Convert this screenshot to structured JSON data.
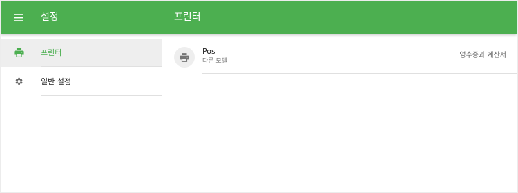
{
  "header": {
    "menu_icon": "hamburger-menu-icon",
    "title": "설정",
    "detail_title": "프린터"
  },
  "sidebar": {
    "items": [
      {
        "label": "프린터",
        "icon": "printer-icon",
        "selected": true
      },
      {
        "label": "일반 설정",
        "icon": "gear-icon",
        "selected": false
      }
    ]
  },
  "printers": [
    {
      "name": "Pos",
      "model": "다른 모델",
      "type": "영수증과 계산서",
      "icon": "printer-icon"
    }
  ],
  "colors": {
    "primary": "#4caf50",
    "selected_bg": "#eeeeee",
    "icon_gray": "#757575"
  }
}
